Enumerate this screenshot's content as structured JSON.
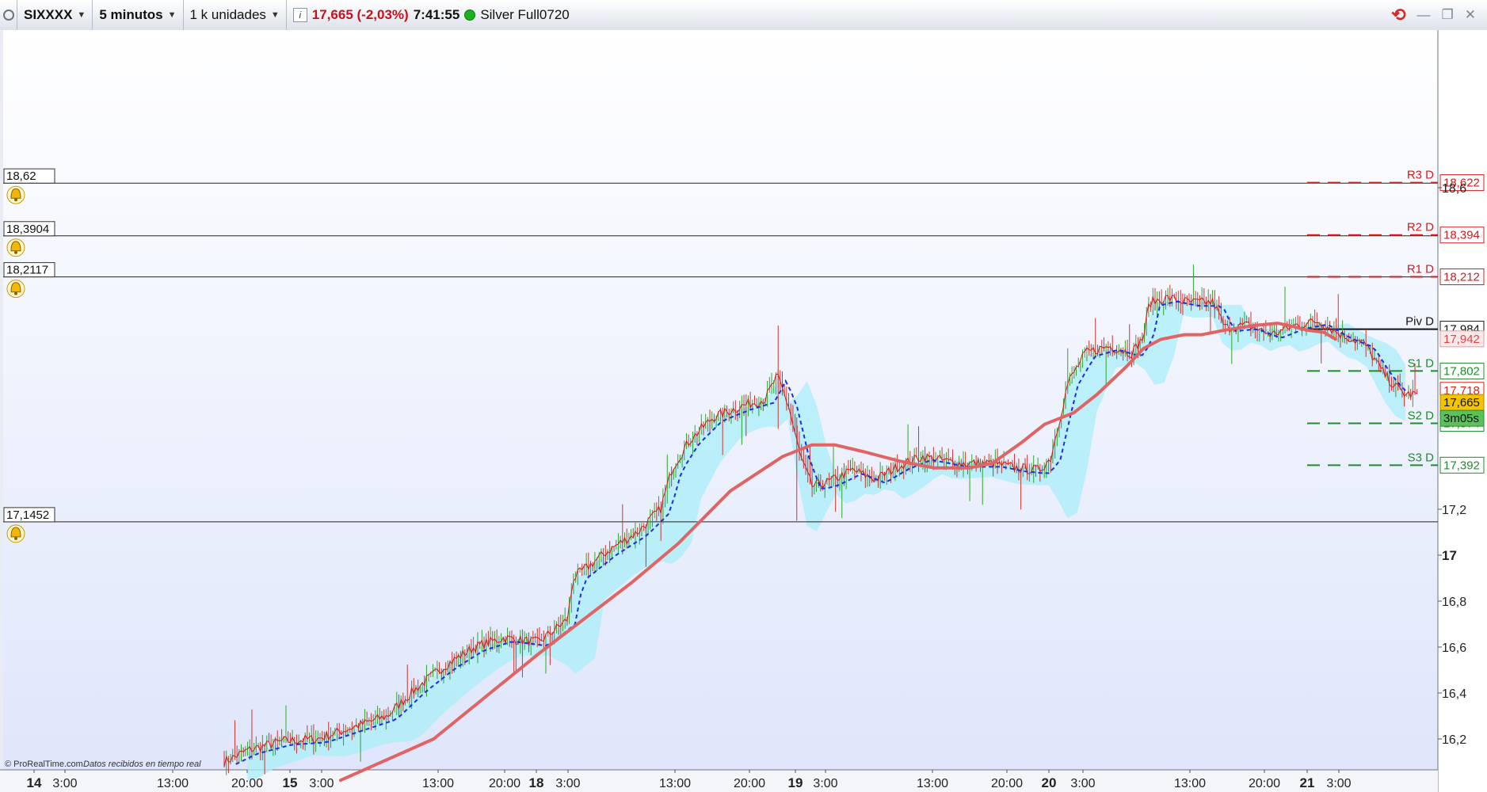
{
  "toolbar": {
    "ticker": "SIXXXX",
    "timeframe": "5 minutos",
    "units": "1 k unidades",
    "info_label": "i",
    "price_change": "17,665 (-2,03%)",
    "time": "7:41:55",
    "connection_label": "Silver Full0720",
    "icons": [
      "grip-icon",
      "caret-down-icon",
      "info-icon",
      "connection-status-icon",
      "refresh-icon",
      "minimize-icon",
      "restore-icon",
      "close-icon"
    ]
  },
  "colors": {
    "price_red": "#c8101d",
    "moving_average": "#e06464",
    "candle_up": "#2ea52e",
    "candle_down": "#d23030",
    "dashed_line": "#1a2fe0",
    "cloud": "#a9eef8",
    "pivot_red": "#cc2020",
    "pivot_green": "#1f8b2d",
    "current_price_bg": "#f5c400",
    "countdown_bg": "#5bc25b",
    "chart_bg_top": "#ffffff",
    "chart_bg_bottom": "#dfe6fb"
  },
  "alert_lines": [
    {
      "label": "18,62",
      "value": 18.62
    },
    {
      "label": "18,3904",
      "value": 18.3904
    },
    {
      "label": "18,2117",
      "value": 18.2117
    },
    {
      "label": "17,1452",
      "value": 17.1452
    }
  ],
  "pivots": [
    {
      "name": "R3 D",
      "label": "18,622",
      "value": 18.622,
      "tone": "red"
    },
    {
      "name": "R2 D",
      "label": "18,394",
      "value": 18.394,
      "tone": "red"
    },
    {
      "name": "R1 D",
      "label": "18,212",
      "value": 18.212,
      "tone": "red"
    },
    {
      "name": "Piv D",
      "label": "17,984",
      "value": 17.984,
      "tone": "black"
    },
    {
      "name": "S1 D",
      "label": "17,802",
      "value": 17.802,
      "tone": "green"
    },
    {
      "name": "S2 D",
      "label": "17,574",
      "value": 17.574,
      "tone": "green"
    },
    {
      "name": "S3 D",
      "label": "17,392",
      "value": 17.392,
      "tone": "green"
    }
  ],
  "axis_markers": [
    {
      "label": "17,942",
      "value": 17.942,
      "kind": "ma"
    },
    {
      "label": "17,718",
      "value": 17.718,
      "kind": "red"
    },
    {
      "label": "17,665",
      "value": 17.665,
      "kind": "current"
    },
    {
      "label": "3m05s",
      "kind": "countdown"
    }
  ],
  "y_ticks": [
    {
      "label": "18,6",
      "value": 18.6
    },
    {
      "label": "17,2",
      "value": 17.2
    },
    {
      "label": "17",
      "value": 17.0,
      "bold": true
    },
    {
      "label": "16,8",
      "value": 16.8
    },
    {
      "label": "16,6",
      "value": 16.6
    },
    {
      "label": "16,4",
      "value": 16.4
    },
    {
      "label": "16,2",
      "value": 16.2
    }
  ],
  "x_ticks": [
    {
      "label": "14",
      "bold": true
    },
    {
      "label": "3:00"
    },
    {
      "label": "13:00"
    },
    {
      "label": "20:00"
    },
    {
      "label": "15",
      "bold": true
    },
    {
      "label": "3:00"
    },
    {
      "label": "13:00"
    },
    {
      "label": "20:00"
    },
    {
      "label": "18",
      "bold": true
    },
    {
      "label": "3:00"
    },
    {
      "label": "13:00"
    },
    {
      "label": "20:00"
    },
    {
      "label": "19",
      "bold": true
    },
    {
      "label": "3:00"
    },
    {
      "label": "13:00"
    },
    {
      "label": "20:00"
    },
    {
      "label": "20",
      "bold": true
    },
    {
      "label": "3:00"
    },
    {
      "label": "13:00"
    },
    {
      "label": "20:00"
    },
    {
      "label": "21",
      "bold": true
    },
    {
      "label": "3:00"
    }
  ],
  "footer": {
    "source": "© ProRealTime.com",
    "realtime_note": "Datos recibidos en tiempo real"
  },
  "chart_data": {
    "type": "line",
    "ylim": [
      16.1,
      18.76
    ],
    "series": [
      {
        "values": [
          [
            0.0,
            16.1
          ],
          [
            2.0,
            16.15
          ],
          [
            5.0,
            16.19
          ],
          [
            8.0,
            16.2
          ],
          [
            11.0,
            16.25
          ],
          [
            14.0,
            16.3
          ],
          [
            16.5,
            16.42
          ],
          [
            19.0,
            16.52
          ],
          [
            21.5,
            16.6
          ],
          [
            24.0,
            16.64
          ],
          [
            27.0,
            16.62
          ],
          [
            29.5,
            16.72
          ],
          [
            30.0,
            16.9
          ],
          [
            33.0,
            17.02
          ],
          [
            35.5,
            17.1
          ],
          [
            37.5,
            17.2
          ],
          [
            38.5,
            17.38
          ],
          [
            40.0,
            17.5
          ],
          [
            42.0,
            17.6
          ],
          [
            44.5,
            17.65
          ],
          [
            46.5,
            17.68
          ],
          [
            47.5,
            17.78
          ],
          [
            48.5,
            17.65
          ],
          [
            49.5,
            17.43
          ],
          [
            50.5,
            17.3
          ],
          [
            52.0,
            17.32
          ],
          [
            54.0,
            17.37
          ],
          [
            56.0,
            17.33
          ],
          [
            58.0,
            17.39
          ],
          [
            60.0,
            17.43
          ],
          [
            63.0,
            17.4
          ],
          [
            66.0,
            17.4
          ],
          [
            68.0,
            17.38
          ],
          [
            70.0,
            17.37
          ],
          [
            71.0,
            17.42
          ],
          [
            72.5,
            17.75
          ],
          [
            74.0,
            17.88
          ],
          [
            76.0,
            17.91
          ],
          [
            78.0,
            17.88
          ],
          [
            79.0,
            17.95
          ],
          [
            79.5,
            18.1
          ],
          [
            81.0,
            18.12
          ],
          [
            83.0,
            18.1
          ],
          [
            85.0,
            18.1
          ],
          [
            86.0,
            17.99
          ],
          [
            88.0,
            18.0
          ],
          [
            90.0,
            17.96
          ],
          [
            92.0,
            18.0
          ],
          [
            94.0,
            18.02
          ],
          [
            96.0,
            17.96
          ],
          [
            98.0,
            17.92
          ],
          [
            99.5,
            17.8
          ],
          [
            100.5,
            17.74
          ],
          [
            101.5,
            17.7
          ],
          [
            102.5,
            17.7
          ]
        ]
      },
      {
        "values": [
          [
            10.0,
            16.02
          ],
          [
            18.0,
            16.2
          ],
          [
            27.0,
            16.57
          ],
          [
            35.0,
            16.88
          ],
          [
            39.0,
            17.05
          ],
          [
            43.5,
            17.28
          ],
          [
            48.0,
            17.43
          ],
          [
            50.5,
            17.48
          ],
          [
            52.5,
            17.48
          ],
          [
            55.0,
            17.45
          ],
          [
            58.0,
            17.41
          ],
          [
            61.0,
            17.38
          ],
          [
            64.0,
            17.38
          ],
          [
            66.0,
            17.4
          ],
          [
            68.5,
            17.49
          ],
          [
            70.5,
            17.57
          ],
          [
            73.0,
            17.62
          ],
          [
            75.0,
            17.7
          ],
          [
            77.5,
            17.82
          ],
          [
            79.0,
            17.9
          ],
          [
            80.5,
            17.94
          ],
          [
            82.5,
            17.96
          ],
          [
            84.0,
            17.96
          ],
          [
            86.0,
            17.98
          ],
          [
            88.5,
            18.0
          ],
          [
            90.5,
            18.01
          ],
          [
            91.5,
            18.0
          ],
          [
            93.0,
            17.98
          ],
          [
            94.5,
            17.97
          ],
          [
            95.5,
            17.94
          ]
        ]
      }
    ]
  }
}
